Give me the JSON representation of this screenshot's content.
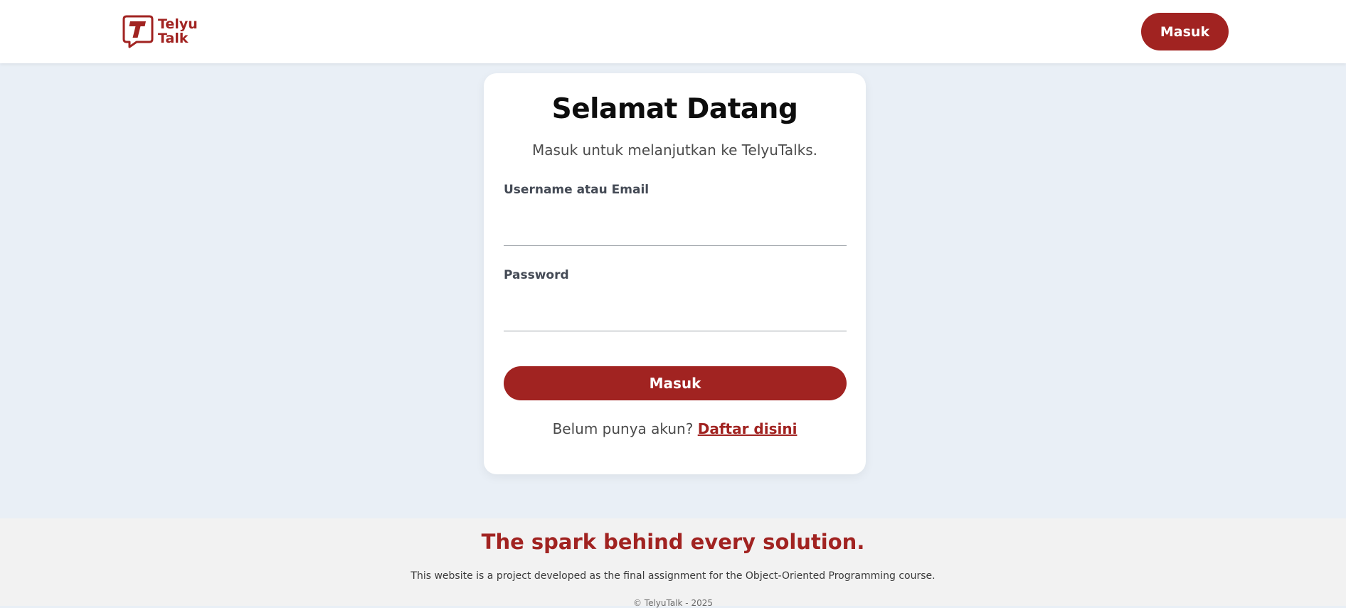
{
  "header": {
    "logo_line1": "Telyu",
    "logo_line2": "Talk",
    "login_button": "Masuk"
  },
  "login_card": {
    "title": "Selamat Datang",
    "subtitle": "Masuk untuk melanjutkan ke TelyuTalks.",
    "username_label": "Username atau Email",
    "username_value": "",
    "password_label": "Password",
    "password_value": "",
    "submit_button": "Masuk",
    "register_prompt": "Belum punya akun?",
    "register_link": "Daftar disini"
  },
  "footer": {
    "tagline": "The spark behind every solution.",
    "description": "This website is a project developed as the final assignment for the Object-Oriented Programming course.",
    "copyright": "© TelyuTalk - 2025"
  },
  "colors": {
    "brand": "#a12321",
    "page_background": "#e9eff6",
    "footer_background": "#f2f2f2"
  },
  "icons": {
    "logo": "speech-bubble-t-logo"
  }
}
